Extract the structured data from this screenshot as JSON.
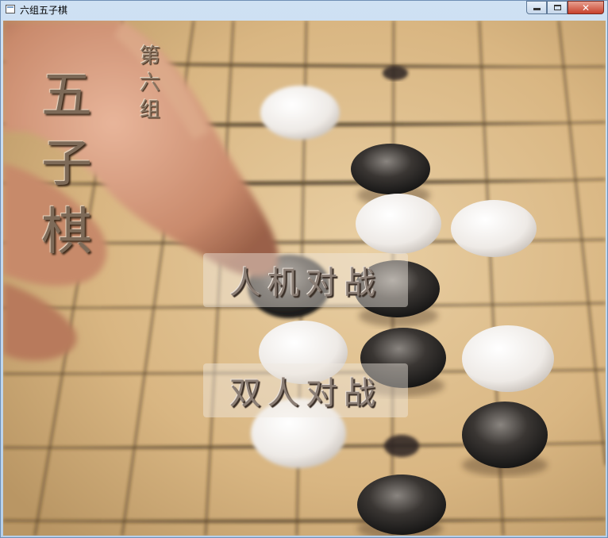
{
  "window": {
    "title": "六组五子棋",
    "icon": "app-window-icon"
  },
  "caption_buttons": {
    "minimize_icon": "minimize-icon",
    "maximize_icon": "maximize-icon",
    "close_icon": "close-icon",
    "close_glyph": "✕"
  },
  "game_title": {
    "chars": [
      "五",
      "子",
      "棋"
    ]
  },
  "group_label": {
    "chars": [
      "第",
      "六",
      "组"
    ]
  },
  "menu": {
    "vs_computer": "人机对战",
    "two_player": "双人对战"
  },
  "colors": {
    "board": "#d9b98a",
    "grid": "#3a2a18",
    "button_bg": "rgba(240,232,225,0.45)"
  }
}
